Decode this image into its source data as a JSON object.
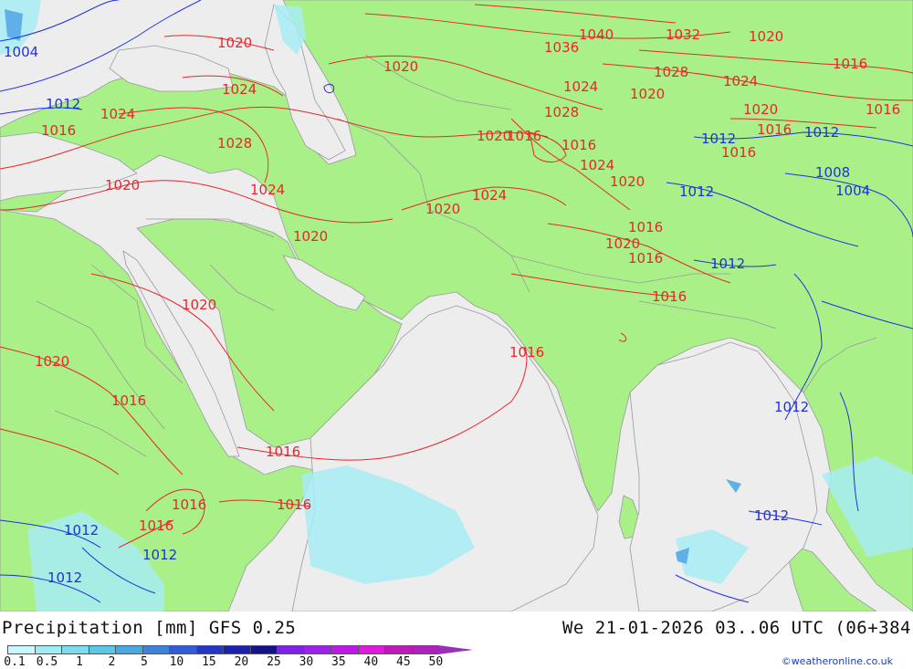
{
  "map": {
    "land_color": "#aaf088",
    "sea_color": "#ededed",
    "isobar_high_color": "#e8262b",
    "isobar_low_color": "#2030e0",
    "precip_light_color": "#a8ecf4",
    "isobar_labels": [
      {
        "text": "1004",
        "color": "blue"
      },
      {
        "text": "1012",
        "color": "blue"
      },
      {
        "text": "1016",
        "color": "red"
      },
      {
        "text": "1020",
        "color": "red"
      },
      {
        "text": "1024",
        "color": "red"
      },
      {
        "text": "1020",
        "color": "red"
      },
      {
        "text": "1020",
        "color": "red"
      },
      {
        "text": "1024",
        "color": "red"
      },
      {
        "text": "1028",
        "color": "red"
      },
      {
        "text": "1024",
        "color": "red"
      },
      {
        "text": "1020",
        "color": "red"
      },
      {
        "text": "1036",
        "color": "red"
      },
      {
        "text": "1040",
        "color": "red"
      },
      {
        "text": "1032",
        "color": "red"
      },
      {
        "text": "1020",
        "color": "red"
      },
      {
        "text": "1016",
        "color": "red"
      },
      {
        "text": "1028",
        "color": "red"
      },
      {
        "text": "1024",
        "color": "red"
      },
      {
        "text": "1024",
        "color": "red"
      },
      {
        "text": "1020",
        "color": "red"
      },
      {
        "text": "1028",
        "color": "red"
      },
      {
        "text": "1020",
        "color": "red"
      },
      {
        "text": "1016",
        "color": "red"
      },
      {
        "text": "1016",
        "color": "red"
      },
      {
        "text": "1012",
        "color": "blue"
      },
      {
        "text": "1016",
        "color": "red"
      },
      {
        "text": "1016",
        "color": "red"
      },
      {
        "text": "1012",
        "color": "blue"
      },
      {
        "text": "1008",
        "color": "blue"
      },
      {
        "text": "1004",
        "color": "blue"
      },
      {
        "text": "1020",
        "color": "red"
      },
      {
        "text": "1016",
        "color": "red"
      },
      {
        "text": "1024",
        "color": "red"
      },
      {
        "text": "1020",
        "color": "red"
      },
      {
        "text": "1024",
        "color": "red"
      },
      {
        "text": "1020",
        "color": "red"
      },
      {
        "text": "1012",
        "color": "blue"
      },
      {
        "text": "1016",
        "color": "red"
      },
      {
        "text": "1020",
        "color": "red"
      },
      {
        "text": "1016",
        "color": "red"
      },
      {
        "text": "1012",
        "color": "blue"
      },
      {
        "text": "1016",
        "color": "red"
      },
      {
        "text": "1020",
        "color": "red"
      },
      {
        "text": "1020",
        "color": "red"
      },
      {
        "text": "1016",
        "color": "red"
      },
      {
        "text": "1016",
        "color": "red"
      },
      {
        "text": "1012",
        "color": "blue"
      },
      {
        "text": "1016",
        "color": "red"
      },
      {
        "text": "1016",
        "color": "red"
      },
      {
        "text": "1016",
        "color": "red"
      },
      {
        "text": "1016",
        "color": "red"
      },
      {
        "text": "1012",
        "color": "blue"
      },
      {
        "text": "1012",
        "color": "blue"
      },
      {
        "text": "1012",
        "color": "blue"
      },
      {
        "text": "1012",
        "color": "blue"
      }
    ]
  },
  "footer": {
    "title_left": "Precipitation [mm] GFS 0.25",
    "title_right": "We 21-01-2026 03..06 UTC (06+384",
    "credit": "©weatheronline.co.uk",
    "scale_colors": [
      "#c8f8fc",
      "#a0ecf4",
      "#7adcec",
      "#58c8e4",
      "#48a8e0",
      "#3c84dc",
      "#2f5cd8",
      "#2236c8",
      "#1a20b0",
      "#14128c",
      "#8020e8",
      "#a020f0",
      "#c018e8",
      "#e018e0",
      "#c018b8",
      "#b020c0"
    ],
    "scale_ticks": [
      "0.1",
      "0.5",
      "1",
      "2",
      "5",
      "10",
      "15",
      "20",
      "25",
      "30",
      "35",
      "40",
      "45",
      "50"
    ]
  }
}
